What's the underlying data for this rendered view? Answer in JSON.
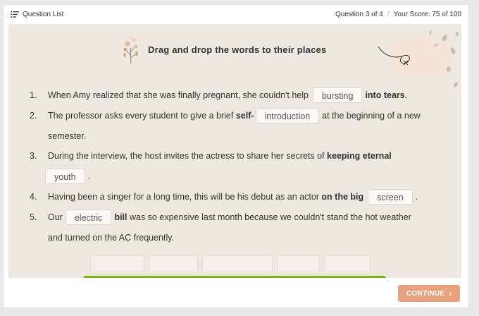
{
  "topbar": {
    "question_list_label": "Question List",
    "question_counter": "Question 3 of 4",
    "score": "Your Score: 75 of 100"
  },
  "quiz": {
    "title": "Drag and drop the words to their places",
    "q1": {
      "number": "1.",
      "before": "When Amy realized that she was finally pregnant, she couldn't help",
      "answer": "bursting",
      "after_bold": "into tears",
      "after": "."
    },
    "q2": {
      "number": "2.",
      "before": "The professor asks every student to give a brief",
      "before_bold": "self-",
      "answer": "introduction",
      "after": "at the beginning of a new",
      "continuation": "semester."
    },
    "q3": {
      "number": "3.",
      "before": "During the interview, the host invites the actress to share her secrets of",
      "before_bold": "keeping eternal",
      "answer": "youth",
      "after": "."
    },
    "q4": {
      "number": "4.",
      "before": "Having been a singer for a long time, this will be his debut as an actor",
      "before_bold": "on the big",
      "answer": "screen",
      "after": "."
    },
    "q5": {
      "number": "5.",
      "before": "Our",
      "answer": "electric",
      "after_bold": "bill",
      "after": "was so expensive last month because we couldn't stand the hot weather",
      "continuation": "and turned on the AC frequently."
    }
  },
  "footer": {
    "continue_label": "CONTINUE",
    "continue_icon": "chevron-right-icon"
  },
  "colors": {
    "quiz_bg": "#efe8e0",
    "continue_button": "#e8a27d",
    "progress_bar": "#7ab51d"
  }
}
